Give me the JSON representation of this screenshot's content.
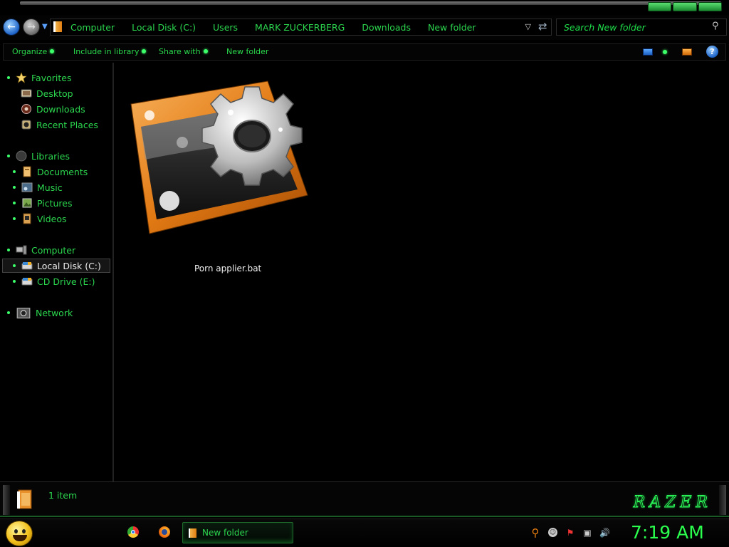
{
  "address": {
    "breadcrumbs": [
      "Computer",
      "Local Disk (C:)",
      "Users",
      "MARK ZUCKERBERG",
      "Downloads",
      "New folder"
    ]
  },
  "search": {
    "placeholder": "Search New folder"
  },
  "toolbar": {
    "organize": "Organize",
    "include_in_library": "Include in library",
    "share_with": "Share with",
    "new_folder": "New folder"
  },
  "nav": {
    "favorites": {
      "label": "Favorites",
      "items": [
        "Desktop",
        "Downloads",
        "Recent Places"
      ]
    },
    "libraries": {
      "label": "Libraries",
      "items": [
        "Documents",
        "Music",
        "Pictures",
        "Videos"
      ]
    },
    "computer": {
      "label": "Computer",
      "items": [
        "Local Disk (C:)",
        "CD Drive (E:)"
      ]
    },
    "network": {
      "label": "Network"
    }
  },
  "files": [
    {
      "name": "Porn applier.bat",
      "icon": "batch-file-gear-icon"
    }
  ],
  "details": {
    "item_count": "1 item"
  },
  "taskbar": {
    "window_label": "New folder",
    "clock": "7:19 AM"
  },
  "colors": {
    "accent_green": "#2bd64e",
    "background": "#000000",
    "folder_orange": "#e88a1a"
  }
}
